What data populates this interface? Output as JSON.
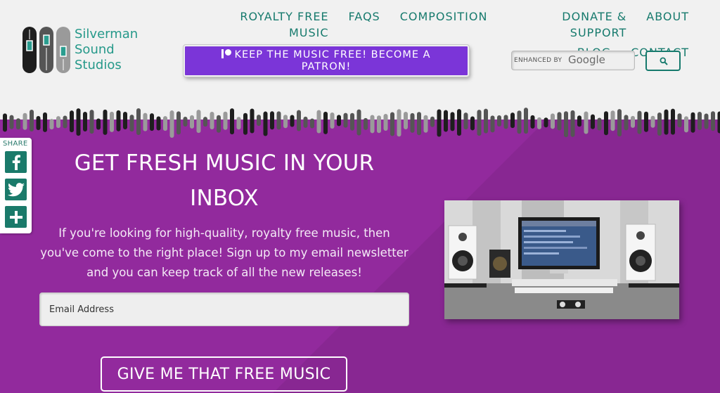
{
  "brand": {
    "line1": "Silverman",
    "line2": "Sound",
    "line3": "Studios"
  },
  "nav": {
    "row1": [
      "ROYALTY FREE MUSIC",
      "FAQS",
      "COMPOSITION",
      "DONATE & SUPPORT",
      "ABOUT"
    ],
    "row2": [
      "BLOG",
      "CONTACT"
    ]
  },
  "patron": {
    "label_line1": "KEEP THE MUSIC FREE! BECOME A",
    "label_line2": "PATRON!"
  },
  "search": {
    "enhanced_by": "ENHANCED BY",
    "google": "Google"
  },
  "share": {
    "label": "SHARE",
    "buttons": [
      "facebook-icon",
      "twitter-icon",
      "plus-icon"
    ]
  },
  "signup": {
    "headline_line1": "GET FRESH MUSIC IN YOUR",
    "headline_line2": "INBOX",
    "lead_line1": "If you're looking for high-quality, royalty free music, then",
    "lead_line2": "you've come to the right place! Sign up to my email newsletter",
    "lead_line3": "and you can keep track of all the new releases!",
    "email_placeholder": "Email Address",
    "cta": "GIVE ME THAT FREE MUSIC"
  },
  "colors": {
    "teal": "#167a6d",
    "purple": "#922a9d",
    "patron": "#7b35d8"
  }
}
